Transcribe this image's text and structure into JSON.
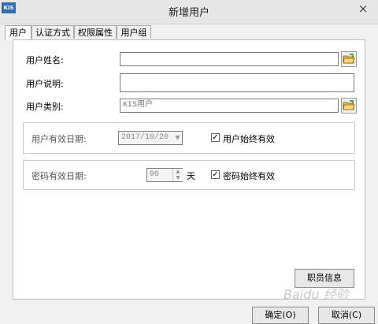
{
  "window": {
    "title": "新增用户",
    "app_icon_text": "KIS",
    "close_glyph": "×"
  },
  "tabs": [
    {
      "label": "用户"
    },
    {
      "label": "认证方式"
    },
    {
      "label": "权限属性"
    },
    {
      "label": "用户组"
    }
  ],
  "form": {
    "user_name": {
      "label": "用户姓名:",
      "value": ""
    },
    "user_desc": {
      "label": "用户说明:",
      "value": ""
    },
    "user_type": {
      "label": "用户类别:",
      "value": "KIS用户"
    }
  },
  "validity": {
    "label": "用户有效日期:",
    "date_value": "2017/10/20",
    "always_label": "用户始终有效",
    "always_checked": true
  },
  "password": {
    "label": "密码有效日期:",
    "days_value": "90",
    "unit": "天",
    "always_label": "密码始终有效",
    "always_checked": true
  },
  "buttons": {
    "staff_info": "职员信息",
    "ok": "确定(O)",
    "cancel": "取消(C)"
  },
  "watermark": "Baidu 经验",
  "icons": {
    "browse": "folder-open-icon",
    "spin_up": "▲",
    "spin_down": "▼",
    "dropdown": "▼",
    "check": "✓"
  }
}
